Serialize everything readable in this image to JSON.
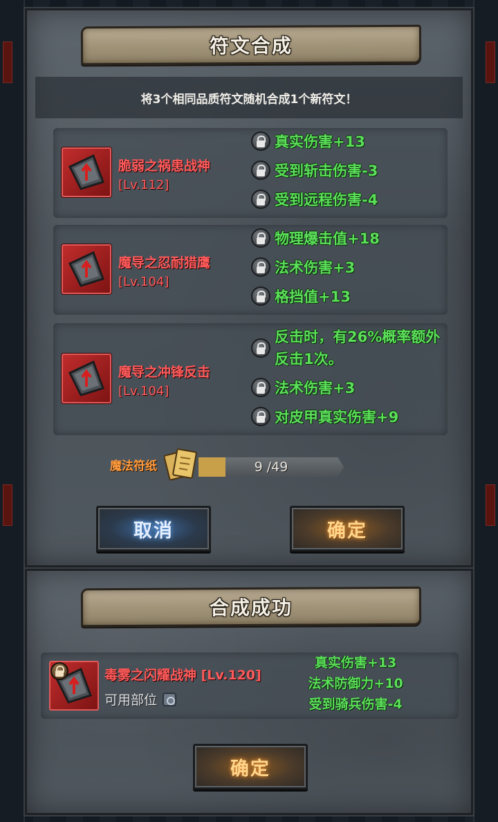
{
  "synthesis_dialog": {
    "title": "符文合成",
    "info": "将3个相同品质符文随机合成1个新符文！",
    "runes": [
      {
        "name": "脆弱之祸患战神",
        "level": "[Lv.112]",
        "attributes": [
          "真实伤害+13",
          "受到斩击伤害-3",
          "受到远程伤害-4"
        ]
      },
      {
        "name": "魔导之忍耐猎鹰",
        "level": "[Lv.104]",
        "attributes": [
          "物理爆击值+18",
          "法术伤害+3",
          "格挡值+13"
        ]
      },
      {
        "name": "魔导之冲锋反击",
        "level": "[Lv.104]",
        "attributes": [
          "反击时，有26%概率额外反击1次。",
          "法术伤害+3",
          "对皮甲真实伤害+9"
        ]
      }
    ],
    "material": {
      "label": "魔法符纸",
      "progress_text": "9 /49",
      "current": 9,
      "max": 49
    },
    "cancel_label": "取消",
    "confirm_label": "确定"
  },
  "success_dialog": {
    "title": "合成成功",
    "result": {
      "name_line": "毒雾之闪耀战神 [Lv.120]",
      "part_label": "可用部位",
      "attributes": [
        "真实伤害+13",
        "法术防御力+10",
        "受到骑兵伤害-4"
      ]
    },
    "confirm_label": "确定"
  },
  "colors": {
    "rune_name": "#ff5a5a",
    "attribute": "#5ce05a",
    "material_label": "#ff9b3e",
    "cancel_glow": "#6fb2ff",
    "confirm_glow": "#ff9e3a"
  },
  "icons": {
    "rune": "rune-shield-arrow-icon",
    "lock": "lock-icon",
    "material": "magic-paper-icon",
    "part": "equipment-slot-icon"
  }
}
